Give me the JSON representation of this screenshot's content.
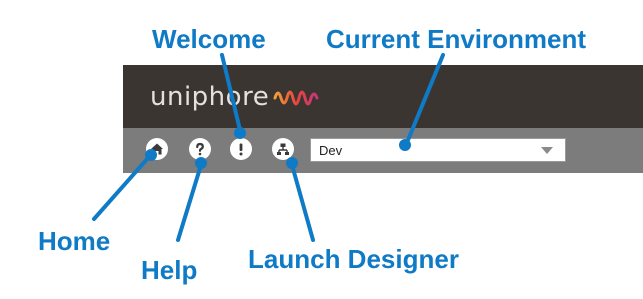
{
  "header": {
    "logo_text": "uniphore"
  },
  "toolbar": {
    "icons": {
      "home": "home-icon",
      "help": "help-icon",
      "welcome": "exclamation-icon",
      "launch_designer": "designer-icon"
    },
    "environment": {
      "selected": "Dev"
    }
  },
  "callouts": {
    "welcome": "Welcome",
    "current_environment": "Current Environment",
    "home": "Home",
    "help": "Help",
    "launch_designer": "Launch Designer"
  },
  "colors": {
    "callout": "#0f7ac5",
    "header_bg": "#3b3532",
    "toolbar_bg": "#7c7c7c",
    "logo_wave": "#e8453c"
  }
}
